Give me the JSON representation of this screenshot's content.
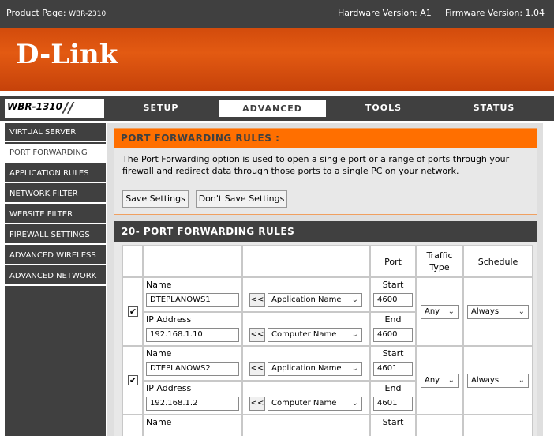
{
  "topbar": {
    "product_prefix": "Product Page: ",
    "product_model": "WBR-2310",
    "hardware": "Hardware Version: A1",
    "firmware": "Firmware Version: 1.04"
  },
  "brand": {
    "logo": "D-Link"
  },
  "nav": {
    "model": "WBR-1310",
    "tabs": [
      {
        "label": "SETUP"
      },
      {
        "label": "ADVANCED"
      },
      {
        "label": "TOOLS"
      },
      {
        "label": "STATUS"
      }
    ]
  },
  "sidebar": {
    "items": [
      {
        "label": "VIRTUAL SERVER"
      },
      {
        "label": "PORT FORWARDING"
      },
      {
        "label": "APPLICATION RULES"
      },
      {
        "label": "NETWORK FILTER"
      },
      {
        "label": "WEBSITE FILTER"
      },
      {
        "label": "FIREWALL SETTINGS"
      },
      {
        "label": "ADVANCED WIRELESS"
      },
      {
        "label": "ADVANCED NETWORK"
      }
    ]
  },
  "intro": {
    "title": "PORT FORWARDING RULES :",
    "line1": "The Port Forwarding option is used to open a single port or a range of ports through your",
    "line2": "firewall and redirect data through those ports to a single PC on your network.",
    "save_label": "Save Settings",
    "dont_save_label": "Don't Save Settings"
  },
  "rules": {
    "title": "20- PORT FORWARDING RULES",
    "headers": {
      "port": "Port",
      "traffic1": "Traffic",
      "traffic2": "Type",
      "schedule": "Schedule"
    },
    "labels": {
      "name": "Name",
      "ip": "IP Address",
      "start": "Start",
      "end": "End",
      "shift": "<<"
    },
    "rows": [
      {
        "checked": "✔",
        "name": "DTEPLANOWS1",
        "app_select": "Application Name",
        "ip": "192.168.1.10",
        "computer_select": "Computer Name",
        "start": "4600",
        "end": "4600",
        "traffic": "Any",
        "schedule": "Always"
      },
      {
        "checked": "✔",
        "name": "DTEPLANOWS2",
        "app_select": "Application Name",
        "ip": "192.168.1.2",
        "computer_select": "Computer Name",
        "start": "4601",
        "end": "4601",
        "traffic": "Any",
        "schedule": "Always"
      },
      {
        "name_label": "Name",
        "start_label": "Start"
      }
    ]
  },
  "icons": {
    "dropdown": "chevron-down-icon",
    "checkmark": "check-icon"
  },
  "colors": {
    "orange": "#ff6f00",
    "banner": "#e35a12",
    "dark": "#404040"
  }
}
